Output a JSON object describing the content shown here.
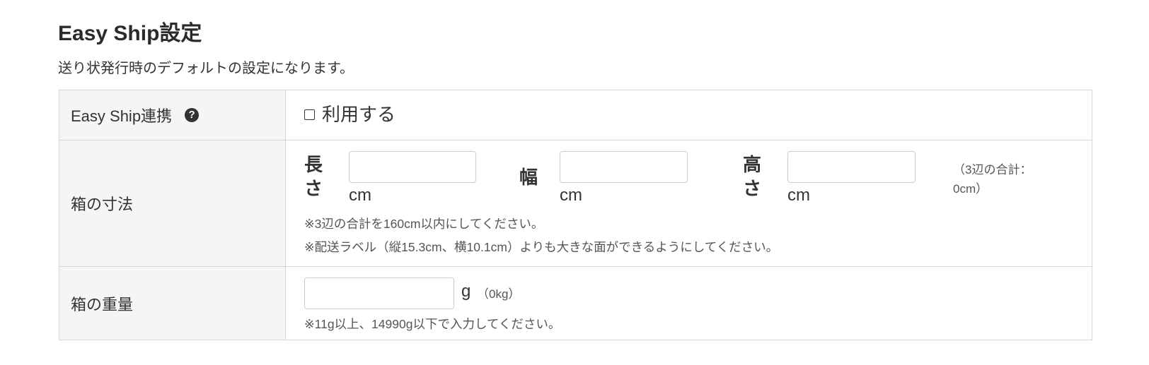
{
  "header": {
    "title": "Easy Ship設定",
    "description": "送り状発行時のデフォルトの設定になります。"
  },
  "rows": {
    "integration": {
      "label": "Easy Ship連携",
      "help_icon": "question-circle-icon",
      "help_glyph": "?",
      "checkbox_label": "利用する",
      "checked": false
    },
    "dimensions": {
      "label": "箱の寸法",
      "length_label_1": "長",
      "length_label_2": "さ",
      "width_label": "幅",
      "height_label_1": "高",
      "height_label_2": "さ",
      "unit": "cm",
      "length_value": "",
      "width_value": "",
      "height_value": "",
      "sum_text": "（3辺の合計：0cm）",
      "note_1": "※3辺の合計を160cm以内にしてください。",
      "note_2": "※配送ラベル（縦15.3cm、横10.1cm）よりも大きな面ができるようにしてください。"
    },
    "weight": {
      "label": "箱の重量",
      "value": "",
      "unit": "g",
      "converted": "（0kg）",
      "note": "※11g以上、14990g以下で入力してください。"
    }
  }
}
